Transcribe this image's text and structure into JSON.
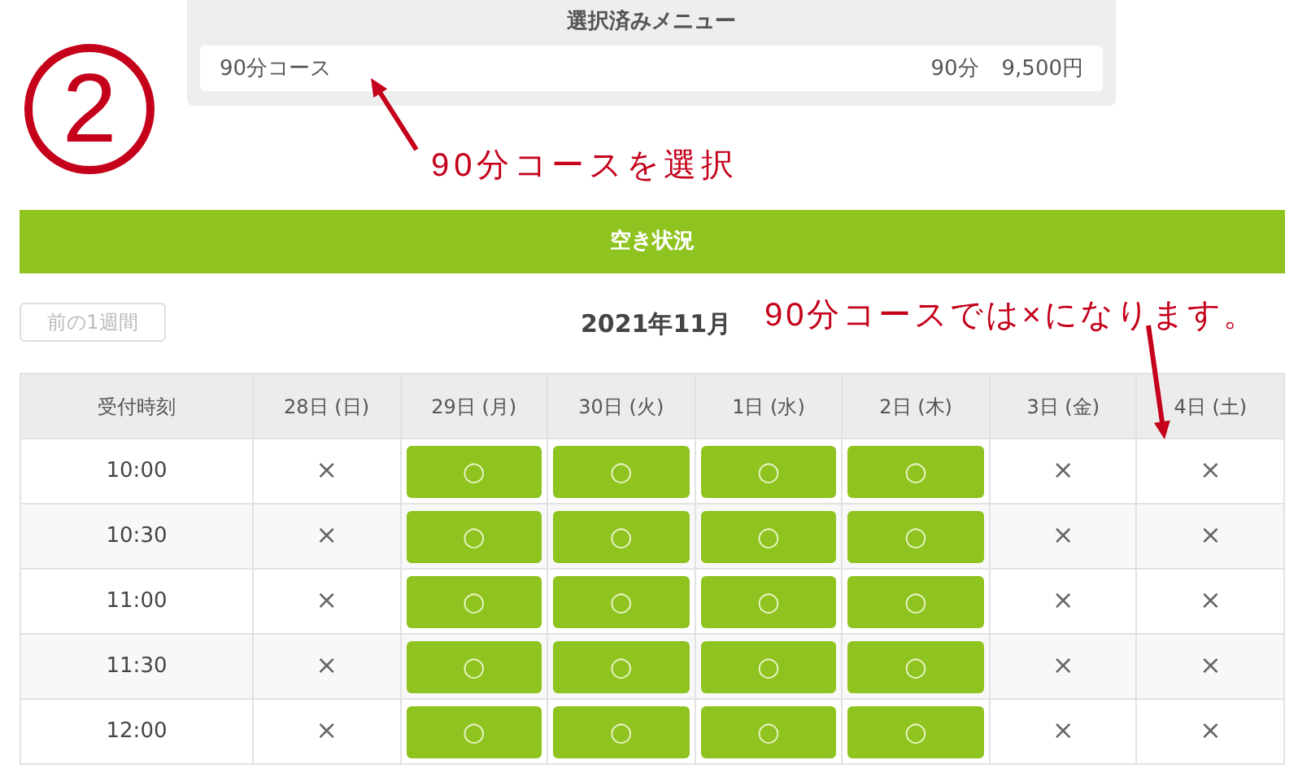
{
  "step_number": "2",
  "selected_menu": {
    "title": "選択済みメニュー",
    "course": "90分コース",
    "duration": "90分",
    "price": "9,500円"
  },
  "annotations": [
    {
      "text": "90分コースを選択",
      "kind": "menu"
    },
    {
      "text": "90分コースでは×になります。",
      "kind": "table"
    }
  ],
  "availability_bar": {
    "title": "空き状況"
  },
  "prev_week_button": {
    "label": "前の1週間",
    "disabled": true
  },
  "month": "2021年11月",
  "table": {
    "columns": [
      "受付時刻",
      "28日 (日)",
      "29日 (月)",
      "30日 (火)",
      "1日 (水)",
      "2日 (木)",
      "3日 (金)",
      "4日 (土)"
    ],
    "rows": [
      {
        "cells": [
          {
            "kind": "time",
            "mark": "10:00"
          },
          {
            "kind": "closed",
            "mark": "×"
          },
          {
            "kind": "open",
            "mark": "○"
          },
          {
            "kind": "open",
            "mark": "○"
          },
          {
            "kind": "open",
            "mark": "○"
          },
          {
            "kind": "open",
            "mark": "○"
          },
          {
            "kind": "closed",
            "mark": "×"
          },
          {
            "kind": "closed",
            "mark": "×"
          }
        ]
      },
      {
        "cells": [
          {
            "kind": "time",
            "mark": "10:30"
          },
          {
            "kind": "closed",
            "mark": "×"
          },
          {
            "kind": "open",
            "mark": "○"
          },
          {
            "kind": "open",
            "mark": "○"
          },
          {
            "kind": "open",
            "mark": "○"
          },
          {
            "kind": "open",
            "mark": "○"
          },
          {
            "kind": "closed",
            "mark": "×"
          },
          {
            "kind": "closed",
            "mark": "×"
          }
        ]
      },
      {
        "cells": [
          {
            "kind": "time",
            "mark": "11:00"
          },
          {
            "kind": "closed",
            "mark": "×"
          },
          {
            "kind": "open",
            "mark": "○"
          },
          {
            "kind": "open",
            "mark": "○"
          },
          {
            "kind": "open",
            "mark": "○"
          },
          {
            "kind": "open",
            "mark": "○"
          },
          {
            "kind": "closed",
            "mark": "×"
          },
          {
            "kind": "closed",
            "mark": "×"
          }
        ]
      },
      {
        "cells": [
          {
            "kind": "time",
            "mark": "11:30"
          },
          {
            "kind": "closed",
            "mark": "×"
          },
          {
            "kind": "open",
            "mark": "○"
          },
          {
            "kind": "open",
            "mark": "○"
          },
          {
            "kind": "open",
            "mark": "○"
          },
          {
            "kind": "open",
            "mark": "○"
          },
          {
            "kind": "closed",
            "mark": "×"
          },
          {
            "kind": "closed",
            "mark": "×"
          }
        ]
      },
      {
        "cells": [
          {
            "kind": "time",
            "mark": "12:00"
          },
          {
            "kind": "closed",
            "mark": "×"
          },
          {
            "kind": "open",
            "mark": "○"
          },
          {
            "kind": "open",
            "mark": "○"
          },
          {
            "kind": "open",
            "mark": "○"
          },
          {
            "kind": "open",
            "mark": "○"
          },
          {
            "kind": "closed",
            "mark": "×"
          },
          {
            "kind": "closed",
            "mark": "×"
          }
        ]
      }
    ]
  }
}
